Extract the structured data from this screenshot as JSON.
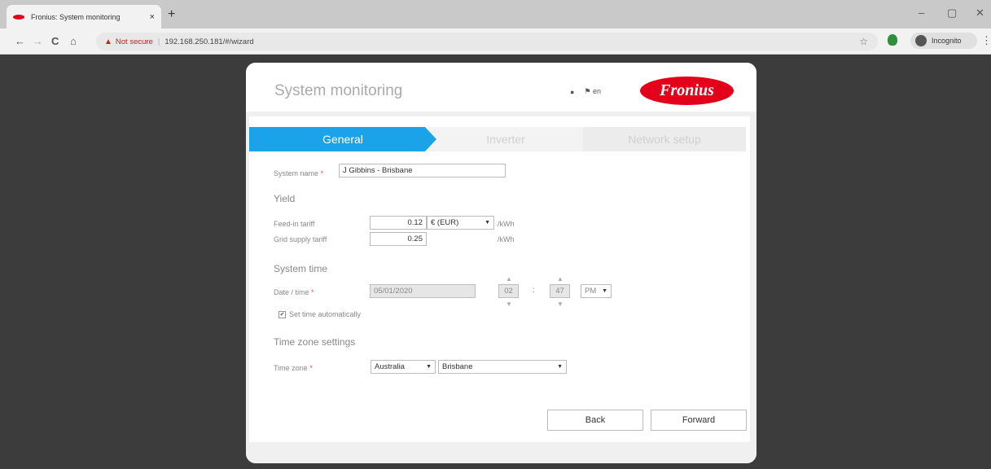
{
  "browser": {
    "tab_title": "Fronius: System monitoring",
    "tab_close": "×",
    "new_tab": "+",
    "back": "←",
    "forward": "→",
    "reload": "C",
    "home": "⌂",
    "warning_icon": "▲",
    "not_secure": "Not secure",
    "url": "192.168.250.181/#/wizard",
    "bookmark_star": "☆",
    "profile_label": "Incognito",
    "menu": "⋮",
    "minimize": "–",
    "maximize": "▢",
    "close": "✕"
  },
  "header": {
    "title": "System monitoring",
    "info_icon": "●",
    "flag_icon": "⚑",
    "language": "en",
    "logo_text": "Fronius"
  },
  "wizard": {
    "steps": [
      "General",
      "Inverter",
      "Network setup"
    ]
  },
  "form": {
    "system_name_label": "System name",
    "required_mark": "*",
    "system_name_value": "J Gibbins - Brisbane",
    "yield_heading": "Yield",
    "feed_in_label": "Feed-in tariff",
    "feed_in_value": "0.12",
    "currency_value": "€ (EUR)",
    "per_kwh": "/kWh",
    "grid_supply_label": "Grid supply tariff",
    "grid_supply_value": "0.25",
    "system_time_heading": "System time",
    "datetime_label": "Date / time",
    "date_value": "05/01/2020",
    "hour_value": "02",
    "minute_value": "47",
    "time_sep": ":",
    "ampm_value": "PM",
    "spin_up": "▲",
    "spin_down": "▼",
    "auto_time_label": "Set time automatically",
    "auto_time_check": "✔",
    "timezone_heading": "Time zone settings",
    "timezone_label": "Time zone",
    "region_value": "Australia",
    "city_value": "Brisbane",
    "dropdown_arrow": "▼"
  },
  "buttons": {
    "back": "Back",
    "forward": "Forward"
  },
  "colors": {
    "accent": "#1aa3e8",
    "brand": "#e3001b"
  }
}
